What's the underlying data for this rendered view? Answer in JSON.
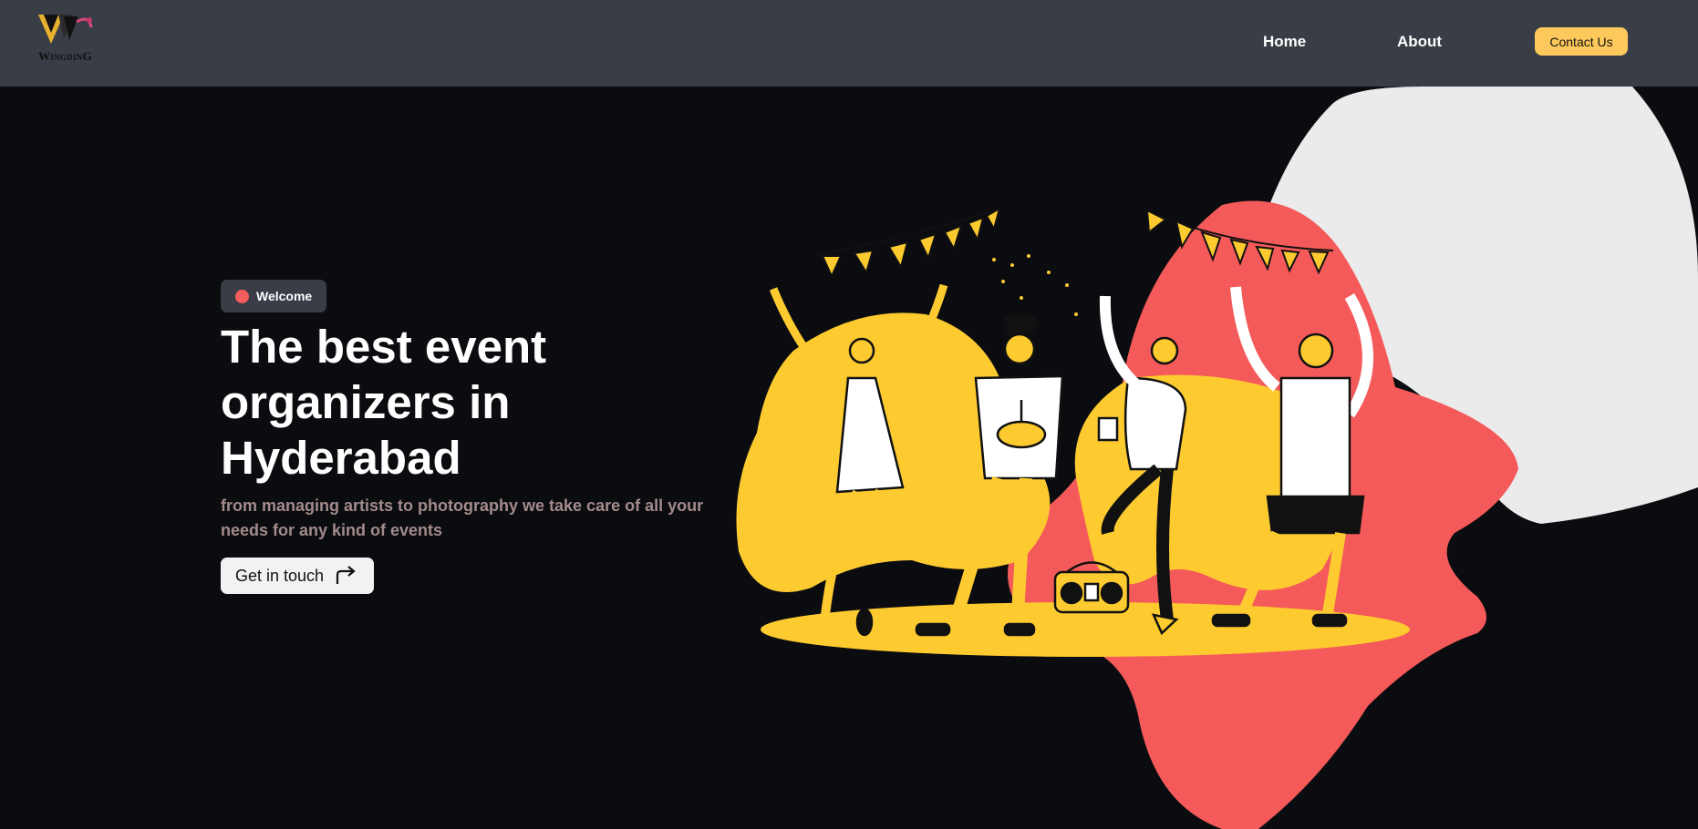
{
  "header": {
    "logo_text": "WingdinG",
    "nav": {
      "home": "Home",
      "about": "About",
      "contact": "Contact Us"
    }
  },
  "hero": {
    "badge": "Welcome",
    "headline_lines": [
      "The best event",
      "organizers in",
      "Hyderabad"
    ],
    "subtitle": "from managing artists to photography we take care of all your needs for any kind of events",
    "cta": "Get in touch"
  },
  "icons": {
    "cta_icon": "arrow-turn-right-icon",
    "badge_icon": "status-dot-icon"
  },
  "colors": {
    "nav_bg": "#393d46",
    "page_bg": "#0b0c10",
    "accent_yellow": "#fdc95c",
    "illustration_yellow": "#fdcb30",
    "illustration_red": "#f55a5a",
    "illustration_gray": "#ebebeb",
    "subtitle": "#a38b8b"
  }
}
